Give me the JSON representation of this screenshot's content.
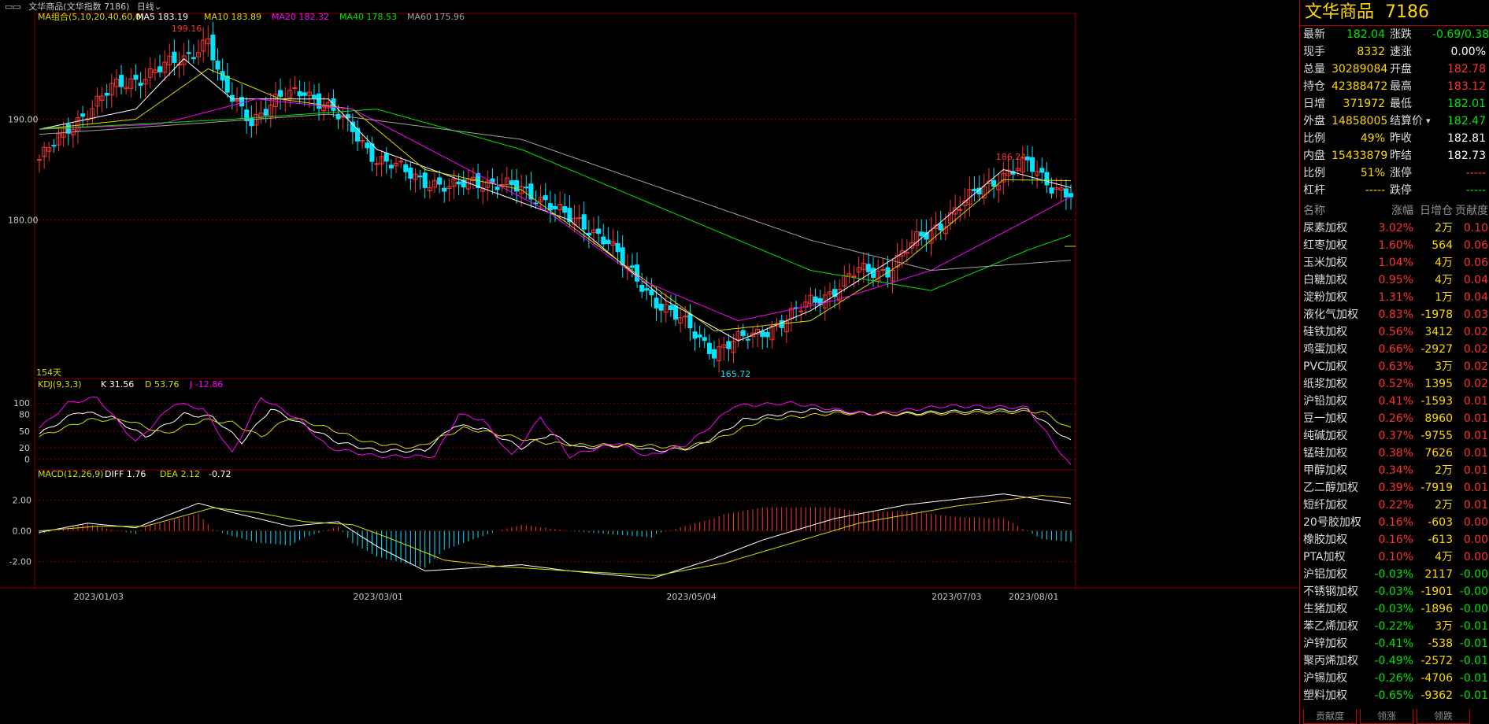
{
  "header": {
    "symbol_title": "文华商品(文华指数 7186)",
    "period": "日线"
  },
  "colors": {
    "up": "#ff3232",
    "down": "#00e5ff",
    "ma5": "#ffffff",
    "ma10": "#d9d900",
    "ma20": "#ff00ff",
    "ma40": "#00e600",
    "ma60": "#a0a0a0",
    "k": "#ffffff",
    "d": "#d9d900",
    "j": "#ff00ff",
    "grid": "#800000"
  },
  "chart_data": [
    {
      "type": "candlestick",
      "legend": {
        "label": "MA组合(5,10,20,40,60,0)",
        "items": [
          {
            "name": "MA5",
            "value": "183.19"
          },
          {
            "name": "MA10",
            "value": "183.89"
          },
          {
            "name": "MA20",
            "value": "182.32"
          },
          {
            "name": "MA40",
            "value": "178.53"
          },
          {
            "name": "MA60",
            "value": "175.96"
          }
        ]
      },
      "yticks": [
        "190.00",
        "180.00"
      ],
      "xticks": [
        "2023/01/03",
        "2023/03/01",
        "2023/05/04",
        "2023/07/03",
        "2023/08/01"
      ],
      "bar_count_label": "154天",
      "annotations": {
        "high": "199.16",
        "low": "165.72",
        "recent_high": "186.24"
      },
      "anchors": [
        [
          0,
          186
        ],
        [
          8,
          190
        ],
        [
          15,
          193
        ],
        [
          25,
          195
        ],
        [
          30,
          196
        ],
        [
          35,
          198
        ],
        [
          38,
          193
        ],
        [
          44,
          190
        ],
        [
          50,
          192
        ],
        [
          55,
          193
        ],
        [
          60,
          191
        ],
        [
          65,
          189
        ],
        [
          70,
          186
        ],
        [
          75,
          185
        ],
        [
          80,
          184
        ],
        [
          85,
          183
        ],
        [
          90,
          184
        ],
        [
          100,
          183
        ],
        [
          105,
          182
        ],
        [
          110,
          180
        ],
        [
          115,
          179
        ],
        [
          118,
          178
        ],
        [
          122,
          175
        ],
        [
          128,
          172
        ],
        [
          133,
          170
        ],
        [
          140,
          167
        ],
        [
          145,
          168
        ],
        [
          150,
          169
        ],
        [
          155,
          170
        ],
        [
          160,
          172
        ],
        [
          165,
          173
        ],
        [
          170,
          175
        ],
        [
          176,
          175
        ],
        [
          182,
          178
        ],
        [
          188,
          180
        ],
        [
          195,
          183
        ],
        [
          200,
          184.5
        ],
        [
          205,
          185.5
        ],
        [
          210,
          183.5
        ],
        [
          214,
          182.5
        ]
      ],
      "ma_anchors": {
        "ma5": [
          [
            0,
            189
          ],
          [
            20,
            191
          ],
          [
            30,
            196
          ],
          [
            40,
            192
          ],
          [
            60,
            192
          ],
          [
            70,
            187
          ],
          [
            90,
            183.5
          ],
          [
            110,
            180
          ],
          [
            130,
            172
          ],
          [
            145,
            168
          ],
          [
            160,
            171
          ],
          [
            180,
            177
          ],
          [
            200,
            185
          ],
          [
            214,
            183.2
          ]
        ],
        "ma10": [
          [
            0,
            189
          ],
          [
            20,
            190
          ],
          [
            35,
            195
          ],
          [
            50,
            192
          ],
          [
            65,
            191
          ],
          [
            80,
            185
          ],
          [
            100,
            183
          ],
          [
            120,
            176
          ],
          [
            140,
            169
          ],
          [
            160,
            170
          ],
          [
            180,
            176
          ],
          [
            200,
            184
          ],
          [
            214,
            183.9
          ]
        ],
        "ma20": [
          [
            0,
            189
          ],
          [
            25,
            189.5
          ],
          [
            45,
            192
          ],
          [
            65,
            191
          ],
          [
            85,
            186
          ],
          [
            105,
            181
          ],
          [
            125,
            174
          ],
          [
            145,
            170
          ],
          [
            165,
            172
          ],
          [
            185,
            175
          ],
          [
            205,
            180
          ],
          [
            214,
            182.3
          ]
        ],
        "ma40": [
          [
            0,
            189
          ],
          [
            40,
            190
          ],
          [
            70,
            191
          ],
          [
            100,
            187
          ],
          [
            130,
            181
          ],
          [
            160,
            175
          ],
          [
            185,
            173
          ],
          [
            205,
            177
          ],
          [
            214,
            178.5
          ]
        ],
        "ma60": [
          [
            0,
            188.5
          ],
          [
            60,
            190.5
          ],
          [
            100,
            188
          ],
          [
            130,
            183
          ],
          [
            160,
            178
          ],
          [
            185,
            175
          ],
          [
            214,
            176
          ]
        ]
      }
    },
    {
      "type": "kdj",
      "legend": {
        "label": "KDJ(9,3,3)",
        "K": "31.56",
        "D": "53.76",
        "J": "-12.86"
      },
      "yticks": [
        "100",
        "80",
        "50",
        "20",
        "0"
      ],
      "k_anchors": [
        [
          0,
          45
        ],
        [
          8,
          85
        ],
        [
          15,
          75
        ],
        [
          22,
          40
        ],
        [
          30,
          80
        ],
        [
          36,
          75
        ],
        [
          42,
          30
        ],
        [
          48,
          90
        ],
        [
          55,
          60
        ],
        [
          62,
          30
        ],
        [
          70,
          15
        ],
        [
          80,
          15
        ],
        [
          86,
          60
        ],
        [
          92,
          55
        ],
        [
          100,
          20
        ],
        [
          106,
          45
        ],
        [
          112,
          20
        ],
        [
          122,
          25
        ],
        [
          128,
          15
        ],
        [
          136,
          20
        ],
        [
          140,
          40
        ],
        [
          146,
          70
        ],
        [
          160,
          88
        ],
        [
          175,
          80
        ],
        [
          190,
          85
        ],
        [
          205,
          88
        ],
        [
          214,
          31.56
        ]
      ],
      "d_anchors": [
        [
          0,
          40
        ],
        [
          10,
          70
        ],
        [
          18,
          70
        ],
        [
          26,
          45
        ],
        [
          34,
          70
        ],
        [
          40,
          65
        ],
        [
          46,
          40
        ],
        [
          52,
          75
        ],
        [
          60,
          55
        ],
        [
          68,
          30
        ],
        [
          78,
          20
        ],
        [
          88,
          55
        ],
        [
          95,
          45
        ],
        [
          104,
          30
        ],
        [
          112,
          25
        ],
        [
          124,
          25
        ],
        [
          134,
          20
        ],
        [
          142,
          40
        ],
        [
          150,
          70
        ],
        [
          165,
          82
        ],
        [
          180,
          80
        ],
        [
          195,
          83
        ],
        [
          208,
          85
        ],
        [
          214,
          53.76
        ]
      ],
      "j_anchors": [
        [
          0,
          55
        ],
        [
          6,
          100
        ],
        [
          12,
          110
        ],
        [
          20,
          30
        ],
        [
          28,
          100
        ],
        [
          34,
          90
        ],
        [
          40,
          10
        ],
        [
          46,
          110
        ],
        [
          54,
          70
        ],
        [
          60,
          20
        ],
        [
          70,
          5
        ],
        [
          82,
          5
        ],
        [
          87,
          80
        ],
        [
          92,
          70
        ],
        [
          98,
          5
        ],
        [
          104,
          75
        ],
        [
          110,
          5
        ],
        [
          120,
          30
        ],
        [
          126,
          5
        ],
        [
          134,
          25
        ],
        [
          138,
          50
        ],
        [
          144,
          95
        ],
        [
          156,
          100
        ],
        [
          172,
          80
        ],
        [
          188,
          95
        ],
        [
          205,
          92
        ],
        [
          214,
          -12.86
        ]
      ]
    },
    {
      "type": "macd",
      "legend": {
        "label": "MACD(12,26,9)",
        "DIFF": "1.76",
        "DEA": "2.12",
        "MACD": "-0.72"
      },
      "yticks": [
        "2.00",
        "0.00",
        "-2.00"
      ],
      "diff_anchors": [
        [
          0,
          -0.1
        ],
        [
          10,
          0.5
        ],
        [
          20,
          0.2
        ],
        [
          33,
          1.8
        ],
        [
          40,
          1.2
        ],
        [
          52,
          0.3
        ],
        [
          62,
          0.6
        ],
        [
          70,
          -1.0
        ],
        [
          80,
          -2.6
        ],
        [
          90,
          -2.4
        ],
        [
          100,
          -2.2
        ],
        [
          110,
          -2.6
        ],
        [
          127,
          -3.1
        ],
        [
          140,
          -1.8
        ],
        [
          150,
          -0.6
        ],
        [
          165,
          0.8
        ],
        [
          180,
          1.7
        ],
        [
          200,
          2.4
        ],
        [
          214,
          1.76
        ]
      ],
      "dea_anchors": [
        [
          0,
          0
        ],
        [
          12,
          0.3
        ],
        [
          22,
          0.3
        ],
        [
          36,
          1.5
        ],
        [
          45,
          1.2
        ],
        [
          55,
          0.6
        ],
        [
          65,
          0.4
        ],
        [
          72,
          -0.4
        ],
        [
          84,
          -1.9
        ],
        [
          95,
          -2.3
        ],
        [
          110,
          -2.6
        ],
        [
          128,
          -2.9
        ],
        [
          142,
          -2.1
        ],
        [
          155,
          -0.9
        ],
        [
          170,
          0.5
        ],
        [
          190,
          1.6
        ],
        [
          208,
          2.3
        ],
        [
          214,
          2.12
        ]
      ]
    }
  ],
  "quote": {
    "title": "文华商品",
    "code": "7186",
    "rows": [
      {
        "l": "最新",
        "lv": "182.04",
        "lc": "green",
        "r": "涨跌",
        "rv": "-0.69/0.38%",
        "rc": "green"
      },
      {
        "l": "现手",
        "lv": "8332",
        "lc": "yellow",
        "r": "速涨",
        "rv": "0.00%",
        "rc": "white"
      },
      {
        "l": "总量",
        "lv": "30289084",
        "lc": "yellow",
        "r": "开盘",
        "rv": "182.78",
        "rc": "red"
      },
      {
        "l": "持仓",
        "lv": "42388472",
        "lc": "yellow",
        "r": "最高",
        "rv": "183.12",
        "rc": "red"
      },
      {
        "l": "日增",
        "lv": "371972",
        "lc": "yellow",
        "r": "最低",
        "rv": "182.01",
        "rc": "green"
      },
      {
        "l": "外盘",
        "lv": "14858005",
        "lc": "yellow",
        "r": "结算价",
        "rv": "182.47",
        "rc": "green"
      },
      {
        "l": "比例",
        "lv": "49%",
        "lc": "yellow",
        "r": "昨收",
        "rv": "182.81",
        "rc": "white"
      },
      {
        "l": "内盘",
        "lv": "15433879",
        "lc": "yellow",
        "r": "昨结",
        "rv": "182.73",
        "rc": "white"
      },
      {
        "l": "比例",
        "lv": "51%",
        "lc": "yellow",
        "r": "涨停",
        "rv": "-----",
        "rc": "red"
      },
      {
        "l": "杠杆",
        "lv": "-----",
        "lc": "yellow",
        "r": "跌停",
        "rv": "-----",
        "rc": "green"
      }
    ]
  },
  "board": {
    "headers": [
      "名称",
      "涨幅",
      "日增仓",
      "贡献度"
    ],
    "rows": [
      {
        "name": "尿素加权",
        "chg": "3.02%",
        "inc": "2万",
        "con": "0.10",
        "c": "red"
      },
      {
        "name": "红枣加权",
        "chg": "1.60%",
        "inc": "564",
        "con": "0.06",
        "c": "red"
      },
      {
        "name": "玉米加权",
        "chg": "1.04%",
        "inc": "4万",
        "con": "0.06",
        "c": "red"
      },
      {
        "name": "白糖加权",
        "chg": "0.95%",
        "inc": "4万",
        "con": "0.04",
        "c": "red"
      },
      {
        "name": "淀粉加权",
        "chg": "1.31%",
        "inc": "1万",
        "con": "0.04",
        "c": "red"
      },
      {
        "name": "液化气加权",
        "chg": "0.83%",
        "inc": "-1978",
        "con": "0.03",
        "c": "red"
      },
      {
        "name": "硅铁加权",
        "chg": "0.56%",
        "inc": "3412",
        "con": "0.02",
        "c": "red"
      },
      {
        "name": "鸡蛋加权",
        "chg": "0.66%",
        "inc": "-2927",
        "con": "0.02",
        "c": "red"
      },
      {
        "name": "PVC加权",
        "chg": "0.63%",
        "inc": "3万",
        "con": "0.02",
        "c": "red"
      },
      {
        "name": "纸浆加权",
        "chg": "0.52%",
        "inc": "1395",
        "con": "0.02",
        "c": "red"
      },
      {
        "name": "沪铅加权",
        "chg": "0.41%",
        "inc": "-1593",
        "con": "0.01",
        "c": "red"
      },
      {
        "name": "豆一加权",
        "chg": "0.26%",
        "inc": "8960",
        "con": "0.01",
        "c": "red"
      },
      {
        "name": "纯碱加权",
        "chg": "0.37%",
        "inc": "-9755",
        "con": "0.01",
        "c": "red"
      },
      {
        "name": "锰硅加权",
        "chg": "0.38%",
        "inc": "7626",
        "con": "0.01",
        "c": "red"
      },
      {
        "name": "甲醇加权",
        "chg": "0.34%",
        "inc": "2万",
        "con": "0.01",
        "c": "red"
      },
      {
        "name": "乙二醇加权",
        "chg": "0.39%",
        "inc": "-7919",
        "con": "0.01",
        "c": "red"
      },
      {
        "name": "短纤加权",
        "chg": "0.22%",
        "inc": "2万",
        "con": "0.01",
        "c": "red"
      },
      {
        "name": "20号胶加权",
        "chg": "0.16%",
        "inc": "-603",
        "con": "0.00",
        "c": "red"
      },
      {
        "name": "橡胶加权",
        "chg": "0.16%",
        "inc": "-613",
        "con": "0.00",
        "c": "red"
      },
      {
        "name": "PTA加权",
        "chg": "0.10%",
        "inc": "4万",
        "con": "0.00",
        "c": "red"
      },
      {
        "name": "沪铝加权",
        "chg": "-0.03%",
        "inc": "2117",
        "con": "-0.00",
        "c": "green"
      },
      {
        "name": "不锈钢加权",
        "chg": "-0.03%",
        "inc": "-1901",
        "con": "-0.00",
        "c": "green"
      },
      {
        "name": "生猪加权",
        "chg": "-0.03%",
        "inc": "-1896",
        "con": "-0.00",
        "c": "green"
      },
      {
        "name": "苯乙烯加权",
        "chg": "-0.22%",
        "inc": "3万",
        "con": "-0.01",
        "c": "green"
      },
      {
        "name": "沪锌加权",
        "chg": "-0.41%",
        "inc": "-538",
        "con": "-0.01",
        "c": "green"
      },
      {
        "name": "聚丙烯加权",
        "chg": "-0.49%",
        "inc": "-2572",
        "con": "-0.01",
        "c": "green"
      },
      {
        "name": "沪锡加权",
        "chg": "-0.26%",
        "inc": "-4706",
        "con": "-0.01",
        "c": "green"
      },
      {
        "name": "塑料加权",
        "chg": "-0.65%",
        "inc": "-9362",
        "con": "-0.01",
        "c": "green"
      }
    ],
    "tabs": [
      "贡献度",
      "领涨",
      "领跌"
    ]
  }
}
